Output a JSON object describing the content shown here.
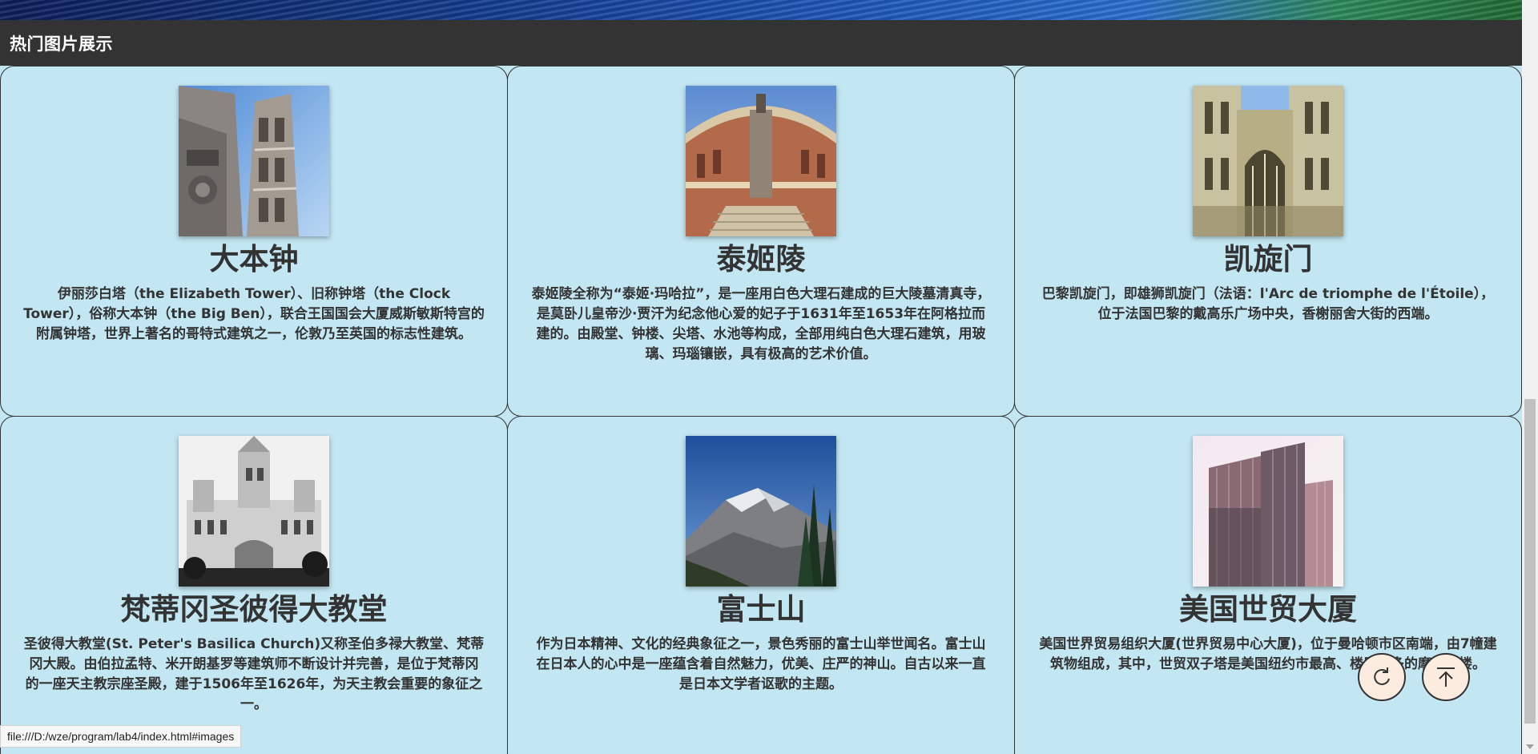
{
  "header": {
    "title": "热门图片展示"
  },
  "cards": [
    {
      "title": "大本钟",
      "description": "伊丽莎白塔（the Elizabeth Tower）、旧称钟塔（the Clock Tower），俗称大本钟（the Big Ben），联合王国国会大厦威斯敏斯特宫的附属钟塔，世界上著名的哥特式建筑之一，伦敦乃至英国的标志性建筑。",
      "image_icon": "gothic-tower-photo"
    },
    {
      "title": "泰姬陵",
      "description": "泰姬陵全称为“泰姬·玛哈拉”，是一座用白色大理石建成的巨大陵墓清真寺，是莫卧儿皇帝沙·贾汗为纪念他心爱的妃子于1631年至1653年在阿格拉而建的。由殿堂、钟楼、尖塔、水池等构成，全部用纯白色大理石建筑，用玻璃、玛瑙镶嵌，具有极高的艺术价值。",
      "image_icon": "round-hall-photo"
    },
    {
      "title": "凯旋门",
      "description": "巴黎凯旋门，即雄狮凯旋门（法语：l'Arc de triomphe de l'Étoile），位于法国巴黎的戴高乐广场中央，香榭丽舍大街的西端。",
      "image_icon": "cathedral-facade-photo"
    },
    {
      "title": "梵蒂冈圣彼得大教堂",
      "description": "圣彼得大教堂(St. Peter's Basilica Church)又称圣伯多禄大教堂、梵蒂冈大殿。由伯拉孟特、米开朗基罗等建筑师不断设计并完善，是位于梵蒂冈的一座天主教宗座圣殿，建于1506年至1626年，为天主教会重要的象征之一。",
      "image_icon": "white-palace-photo"
    },
    {
      "title": "富士山",
      "description": "作为日本精神、文化的经典象征之一，景色秀丽的富士山举世闻名。富士山在日本人的心中是一座蕴含着自然魅力，优美、庄严的神山。自古以来一直是日本文学者讴歌的主题。",
      "image_icon": "mountain-photo"
    },
    {
      "title": "美国世贸大厦",
      "description": "美国世界贸易组织大厦(世界贸易中心大厦)，位于曼哈顿市区南端，由7幢建筑物组成，其中，世贸双子塔是美国纽约市最高、楼层最多的摩天大楼。",
      "image_icon": "skyscraper-photo"
    }
  ],
  "floating_buttons": {
    "refresh_icon": "refresh-icon",
    "top_icon": "arrow-up-to-top-icon"
  },
  "status_bar": {
    "url": "file:///D:/wze/program/lab4/index.html#images"
  },
  "colors": {
    "background": "#c3e7f2",
    "header": "#333333",
    "fab": "#fcece0"
  }
}
